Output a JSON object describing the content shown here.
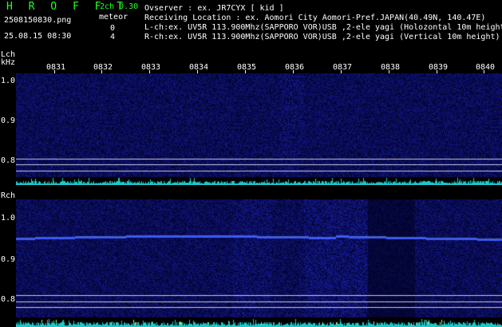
{
  "header": {
    "app_title": "H R O F F T",
    "channel_mode": "2ch 0.30",
    "filename": "2508150830.png",
    "meteor_label": "meteor",
    "meteor_count_lch": "0",
    "meteor_count_rch": "4",
    "datetime": "25.08.15 08:30"
  },
  "info": {
    "observer": "Ovserver            : ex. JR7CYX [ kid ]",
    "location": "Receiving Location : ex. Aomori City Aomori-Pref.JAPAN(40.49N, 140.47E)",
    "lch": "L-ch:ex. UV5R 113.900Mhz(SAPPORO VOR)USB ,2-ele yagi (Holozontal 10m height)",
    "rch": "R-ch:ex. UV5R 113.900Mhz(SAPPORO VOR)USB ,2-ele yagi (Vertical 10m height)"
  },
  "axes": {
    "lch_label": "Lch",
    "khz_label": "kHz",
    "rch_label": "Rch",
    "time_ticks": [
      "0831",
      "0832",
      "0833",
      "0834",
      "0835",
      "0836",
      "0837",
      "0838",
      "0839",
      "0840"
    ],
    "lch_freq_ticks": [
      "1.0",
      "0.9",
      "0.8"
    ],
    "rch_freq_ticks": [
      "1.0",
      "0.9",
      "0.8"
    ]
  },
  "colors": {
    "title_green": "#22ff22",
    "background": "#000000",
    "spectrum_base": "#0a0a50",
    "carrier_trace": "#3a5aff",
    "noise_floor": "#1ec8c8",
    "reference_line": "#c8c8e6"
  }
}
